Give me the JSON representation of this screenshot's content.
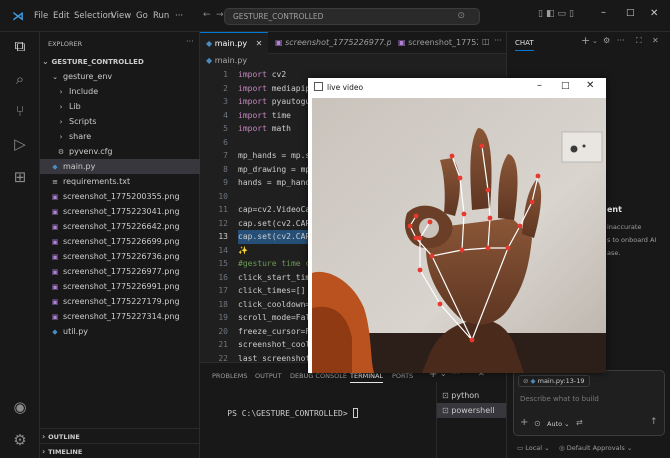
{
  "titlebar": {
    "menus": [
      "File",
      "Edit",
      "Selection",
      "View",
      "Go",
      "Run",
      "···"
    ],
    "search_text": "GESTURE_CONTROLLED"
  },
  "explorer": {
    "header": "EXPLORER",
    "root": "GESTURE_CONTROLLED",
    "items": [
      {
        "label": "gesture_env",
        "kind": "folder-open",
        "indent": 1
      },
      {
        "label": "Include",
        "kind": "folder",
        "indent": 2
      },
      {
        "label": "Lib",
        "kind": "folder",
        "indent": 2
      },
      {
        "label": "Scripts",
        "kind": "folder",
        "indent": 2
      },
      {
        "label": "share",
        "kind": "folder",
        "indent": 2
      },
      {
        "label": "pyvenv.cfg",
        "kind": "gear",
        "indent": 2
      },
      {
        "label": "main.py",
        "kind": "py",
        "indent": 1,
        "selected": true
      },
      {
        "label": "requirements.txt",
        "kind": "txt",
        "indent": 1
      },
      {
        "label": "screenshot_1775200355.png",
        "kind": "img",
        "indent": 1
      },
      {
        "label": "screenshot_1775223041.png",
        "kind": "img",
        "indent": 1
      },
      {
        "label": "screenshot_1775226642.png",
        "kind": "img",
        "indent": 1
      },
      {
        "label": "screenshot_1775226699.png",
        "kind": "img",
        "indent": 1
      },
      {
        "label": "screenshot_1775226736.png",
        "kind": "img",
        "indent": 1
      },
      {
        "label": "screenshot_1775226977.png",
        "kind": "img",
        "indent": 1
      },
      {
        "label": "screenshot_1775226991.png",
        "kind": "img",
        "indent": 1
      },
      {
        "label": "screenshot_1775227179.png",
        "kind": "img",
        "indent": 1
      },
      {
        "label": "screenshot_1775227314.png",
        "kind": "img",
        "indent": 1
      },
      {
        "label": "util.py",
        "kind": "py",
        "indent": 1
      }
    ],
    "outline": "OUTLINE",
    "timeline": "TIMELINE"
  },
  "tabs": [
    {
      "label": "main.py",
      "active": true
    },
    {
      "label": "screenshot_1775226977.png",
      "active": false
    },
    {
      "label": "screenshot_1775200",
      "active": false
    }
  ],
  "breadcrumb": "main.py",
  "code_lines": [
    {
      "n": "1",
      "text": "import cv2",
      "kw": true
    },
    {
      "n": "2",
      "text": "import mediapipe as mp",
      "kw": true
    },
    {
      "n": "3",
      "text": "import pyautogui",
      "kw": true
    },
    {
      "n": "4",
      "text": "import time",
      "kw": true
    },
    {
      "n": "5",
      "text": "import math",
      "kw": true
    },
    {
      "n": "6",
      "text": ""
    },
    {
      "n": "7",
      "text": "mp_hands = mp.solutions.hands"
    },
    {
      "n": "8",
      "text": "mp_drawing = mp.solutions"
    },
    {
      "n": "9",
      "text": "hands = mp_hands.Hands("
    },
    {
      "n": "10",
      "text": ""
    },
    {
      "n": "11",
      "text": "cap=cv2.VideoCapture(0)"
    },
    {
      "n": "12",
      "text": "cap.set(cv2.CAP_PROP_"
    },
    {
      "n": "13",
      "text": "cap.set(cv2.CAP_PROP_",
      "hl": true
    },
    {
      "n": "14",
      "text": "✨",
      "spark": true
    },
    {
      "n": "15",
      "text": "#gesture time control",
      "cm": true
    },
    {
      "n": "16",
      "text": "click_start_time=None"
    },
    {
      "n": "17",
      "text": "click_times=[]"
    },
    {
      "n": "18",
      "text": "click_cooldown=0.5"
    },
    {
      "n": "19",
      "text": "scroll_mode=False"
    },
    {
      "n": "20",
      "text": "freeze_cursor=False"
    },
    {
      "n": "21",
      "text": "screenshot_cooldown"
    },
    {
      "n": "22",
      "text": "last_screenshot_time"
    },
    {
      "n": "23",
      "text": ""
    }
  ],
  "panel": {
    "tabs": [
      "PROBLEMS",
      "OUTPUT",
      "DEBUG CONSOLE",
      "TERMINAL",
      "PORTS"
    ],
    "active_tab": "TERMINAL",
    "prompt": "PS C:\\GESTURE_CONTROLLED> "
  },
  "terminals": [
    {
      "label": "python",
      "active": false
    },
    {
      "label": "powershell",
      "active": true
    }
  ],
  "chat": {
    "title": "CHAT",
    "heading_partial": "ent",
    "text_lines": [
      "inaccurate",
      "s to onboard AI",
      "ase."
    ],
    "context_file": "main.py:13-19",
    "input_placeholder": "Describe what to build",
    "mode": "Auto",
    "footer_local": "Local",
    "footer_approvals": "Default Approvals"
  },
  "livewindow": {
    "title": "live video"
  },
  "colors": {
    "accent": "#0078d4",
    "landmark": "#e8392e",
    "bone": "#ffffff"
  }
}
